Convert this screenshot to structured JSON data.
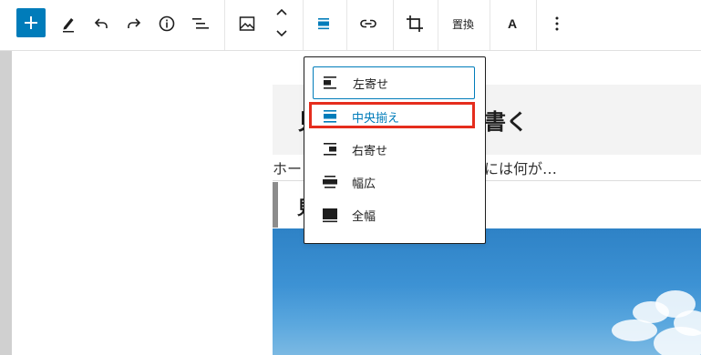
{
  "toolbar": {
    "add_button": "add-block",
    "replace_label": "置換",
    "text_label": "A"
  },
  "editor": {
    "heading_left": "見",
    "heading_right": "書く",
    "paragraph_left": "ホー",
    "paragraph_right": "には何が…",
    "quote_char": "見"
  },
  "align_menu": {
    "items": [
      {
        "label": "左寄せ",
        "icon": "align-left-icon"
      },
      {
        "label": "中央揃え",
        "icon": "align-center-icon"
      },
      {
        "label": "右寄せ",
        "icon": "align-right-icon"
      },
      {
        "label": "幅広",
        "icon": "align-wide-icon"
      },
      {
        "label": "全幅",
        "icon": "align-full-icon"
      }
    ],
    "selected_index": 1
  },
  "colors": {
    "accent": "#007cba",
    "highlight": "#e52d1d"
  }
}
